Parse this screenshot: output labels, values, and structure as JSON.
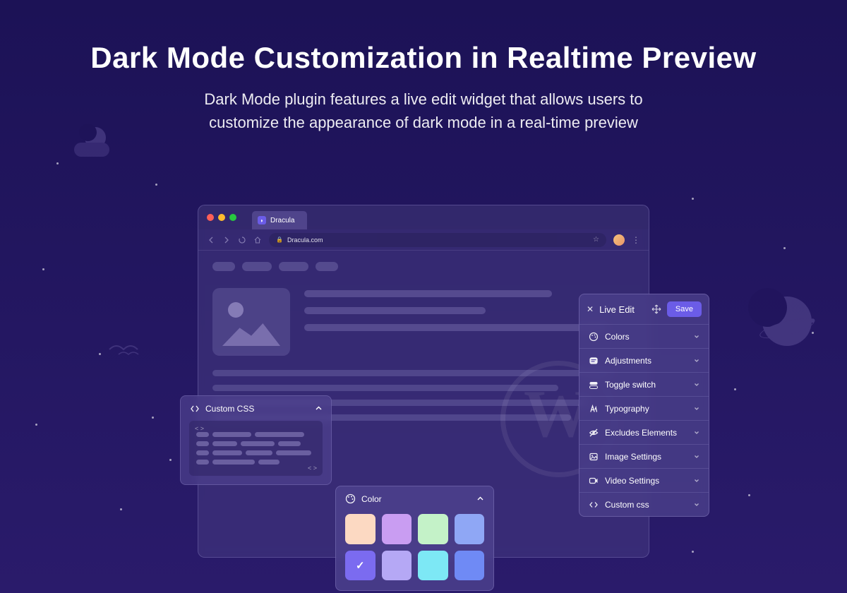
{
  "hero": {
    "title": "Dark Mode Customization in Realtime  Preview",
    "subtitle": "Dark Mode plugin features a live edit widget that allows users to customize the appearance of dark mode in a real-time preview"
  },
  "browser": {
    "tab_label": "Dracula",
    "url": "Dracula.com"
  },
  "live_edit": {
    "title": "Live Edit",
    "save_label": "Save",
    "items": [
      {
        "icon": "palette",
        "label": "Colors"
      },
      {
        "icon": "sliders",
        "label": "Adjustments"
      },
      {
        "icon": "toggle",
        "label": "Toggle switch"
      },
      {
        "icon": "typography",
        "label": "Typography"
      },
      {
        "icon": "eye-off",
        "label": "Excludes Elements"
      },
      {
        "icon": "image",
        "label": "Image Settings"
      },
      {
        "icon": "video",
        "label": "Video Settings"
      },
      {
        "icon": "code",
        "label": "Custom css"
      }
    ]
  },
  "custom_css_panel": {
    "title": "Custom CSS"
  },
  "color_panel": {
    "title": "Color",
    "swatches": [
      "#fcd9c2",
      "#c99df2",
      "#c4f2c8",
      "#8fa7f5",
      "#7b6bf0",
      "#b5a8f5",
      "#7de8f5",
      "#6f8af5"
    ],
    "selected_index": 4
  }
}
